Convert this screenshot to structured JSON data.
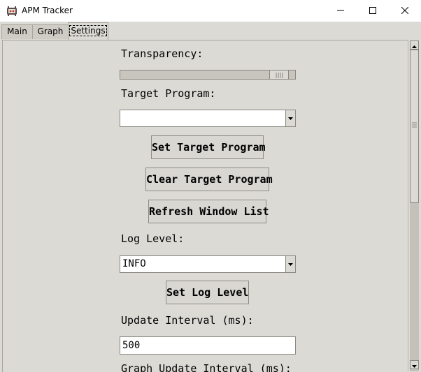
{
  "window": {
    "title": "APM Tracker",
    "app_icon": "apm-tracker-app-icon",
    "controls": [
      "minimize-icon",
      "maximize-icon",
      "close-icon"
    ]
  },
  "tabs": [
    {
      "label": "Main",
      "active": false
    },
    {
      "label": "Graph",
      "active": false
    },
    {
      "label": "Settings",
      "active": true
    }
  ],
  "settings": {
    "transparency_label": "Transparency:",
    "transparency_value": 0.96,
    "target_program_label": "Target Program:",
    "target_program_value": "",
    "set_target_button": "Set Target Program",
    "clear_target_button": "Clear Target Program",
    "refresh_button": "Refresh Window List",
    "log_level_label": "Log Level:",
    "log_level_value": "INFO",
    "set_log_level_button": "Set Log Level",
    "update_interval_label": "Update Interval (ms):",
    "update_interval_value": "500",
    "graph_update_interval_label": "Graph Update Interval (ms):"
  },
  "icons": {
    "dropdown": "chevron-down-icon",
    "scroll_up": "arrow-up-icon",
    "scroll_down": "arrow-down-icon"
  }
}
